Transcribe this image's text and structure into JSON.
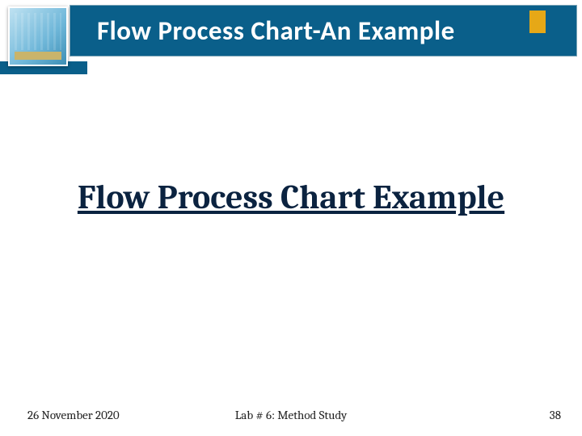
{
  "header": {
    "title": "Flow Process Chart-An Example"
  },
  "main": {
    "link_text": "Flow Process Chart Example"
  },
  "footer": {
    "date": "26 November 2020",
    "center": "Lab # 6: Method Study",
    "page_number": "38"
  }
}
